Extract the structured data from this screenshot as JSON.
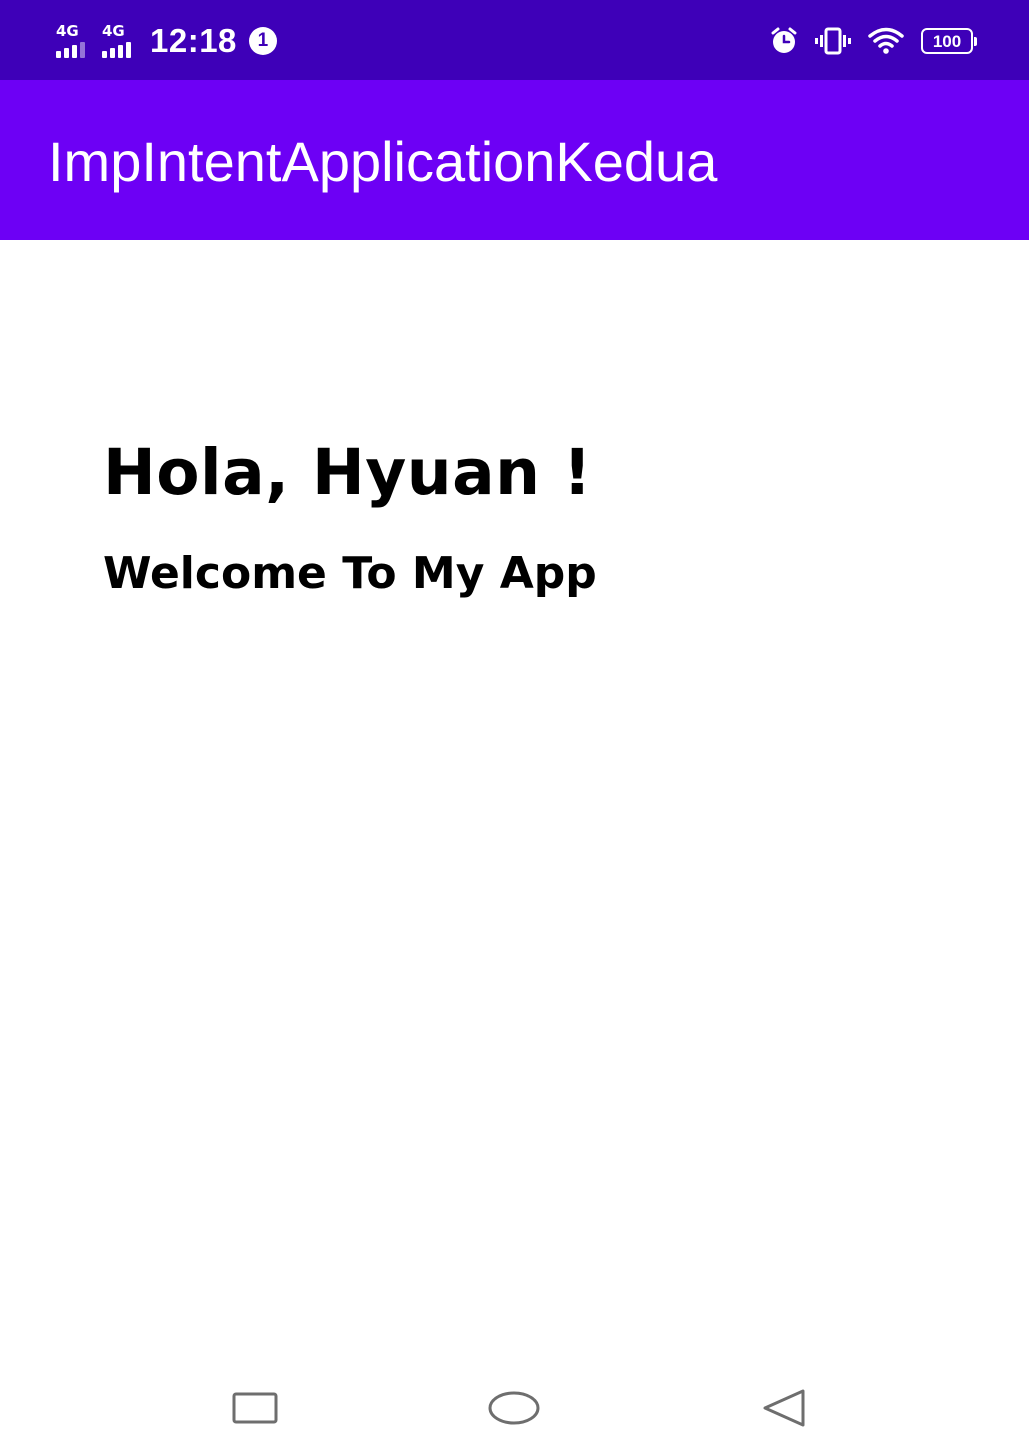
{
  "status_bar": {
    "signal_1_label": "4G",
    "signal_2_label": "4G",
    "time": "12:18",
    "notification_count": "1",
    "battery_level": "100",
    "icons": [
      "alarm-icon",
      "vibrate-icon",
      "wifi-icon",
      "battery-icon"
    ]
  },
  "app_bar": {
    "title": "ImpIntentApplicationKedua"
  },
  "content": {
    "greeting": "Hola, Hyuan !",
    "welcome": "Welcome To My App"
  },
  "nav_bar": {
    "icons": [
      "recents-icon",
      "home-icon",
      "back-icon"
    ]
  },
  "colors": {
    "status_bar": "#3e00b8",
    "app_bar": "#6d00f5",
    "text": "#000000",
    "background": "#ffffff"
  }
}
